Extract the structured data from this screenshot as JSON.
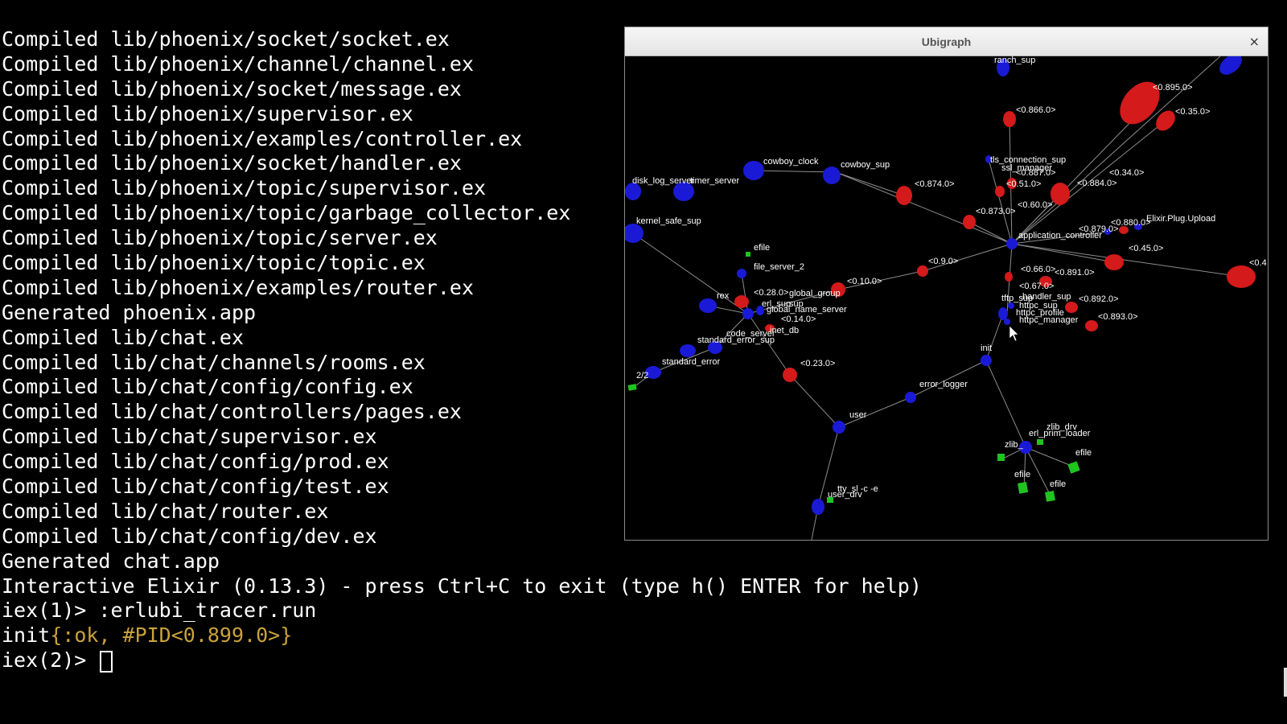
{
  "terminal": {
    "lines": [
      "Compiled lib/phoenix/socket/socket.ex",
      "Compiled lib/phoenix/channel/channel.ex",
      "Compiled lib/phoenix/socket/message.ex",
      "Compiled lib/phoenix/supervisor.ex",
      "Compiled lib/phoenix/examples/controller.ex",
      "Compiled lib/phoenix/socket/handler.ex",
      "Compiled lib/phoenix/topic/supervisor.ex",
      "Compiled lib/phoenix/topic/garbage_collector.ex",
      "Compiled lib/phoenix/topic/server.ex",
      "Compiled lib/phoenix/topic/topic.ex",
      "Compiled lib/phoenix/examples/router.ex",
      "Generated phoenix.app",
      "Compiled lib/chat.ex",
      "Compiled lib/chat/channels/rooms.ex",
      "Compiled lib/chat/config/config.ex",
      "Compiled lib/chat/controllers/pages.ex",
      "Compiled lib/chat/supervisor.ex",
      "Compiled lib/chat/config/prod.ex",
      "Compiled lib/chat/config/test.ex",
      "Compiled lib/chat/router.ex",
      "Compiled lib/chat/config/dev.ex",
      "Generated chat.app",
      "Interactive Elixir (0.13.3) - press Ctrl+C to exit (type h() ENTER for help)",
      "iex(1)> :erlubi_tracer.run"
    ],
    "result_prefix": "init",
    "result_value": "{:ok, #PID<0.899.0>}",
    "prompt": "iex(2)> ",
    "text_color": "#ffffff",
    "accent_color": "#c8a23a"
  },
  "window": {
    "title": "Ubigraph",
    "close_label": "×"
  },
  "graph": {
    "colors": {
      "process": "#1a1ad6",
      "pid": "#d41a1a",
      "port": "#1fc41f",
      "edge": "#8c8c8c"
    },
    "labels": {
      "ranch_sup": "ranch_sup",
      "pid_895": "<0.895.0>",
      "pid_35": "<0.35.0>",
      "pid_866": "<0.866.0>",
      "tls_connection_sup": "tls_connection_sup",
      "ssl_manager": "ssl_manager",
      "pid_887": "<0.887.0>",
      "pid_51": "<0.51.0>",
      "pid_34": "<0.34.0>",
      "pid_884": "<0.884.0>",
      "pid_60": "<0.60.0>",
      "cowboy_clock": "cowboy_clock",
      "cowboy_sup": "cowboy_sup",
      "disk_log_server": "disk_log_server",
      "timer_server": "timer_server",
      "pid_874": "<0.874.0>",
      "pid_873": "<0.873.0>",
      "pid_879": "<0.879.0>",
      "pid_880": "<0.880.0>",
      "plug_upload": "Elixir.Plug.Upload",
      "kernel_safe_sup": "kernel_safe_sup",
      "application_controller": "application_controller",
      "pid_45": "<0.45.0>",
      "pid_edge": "<0.4",
      "efile": "efile",
      "file_server_2": "file_server_2",
      "pid_9": "<0.9.0>",
      "pid_66": "<0.66.0>",
      "pid_891": "<0.891.0>",
      "pid_10": "<0.10.0>",
      "pid_67": "<0.67.0>",
      "pid_28": "<0.28.0>",
      "global_group": "global_group",
      "rex": "rex",
      "erl_sup": "erl_sup",
      "sup_label": "sup",
      "global_name_server": "global_name_server",
      "tftp_sup": "tftp_sup",
      "handler_sup": "handler_sup",
      "httpc_sup": "httpc_sup",
      "httpc_profile": "httpc_profile",
      "httpc_manager": "httpc_manager",
      "pid_892": "<0.892.0>",
      "pid_893": "<0.893.0>",
      "pid_14": "<0.14.0>",
      "inet_db": "inet_db",
      "code_server": "code_server",
      "standard_error_sup": "standard_error_sup",
      "init": "init",
      "standard_error": "standard_error",
      "pid_23": "<0.23.0>",
      "port_22": "2/2",
      "error_logger": "error_logger",
      "user": "user",
      "zlib_drv": "zlib_drv",
      "erl_prim_loader": "erl_prim_loader",
      "zlib": "zlib_",
      "efile_a": "efile",
      "efile_b": "efile",
      "efile_c": "efile",
      "tty_sl": "tty_sl -c -e",
      "user_drv": "user_drv"
    }
  }
}
